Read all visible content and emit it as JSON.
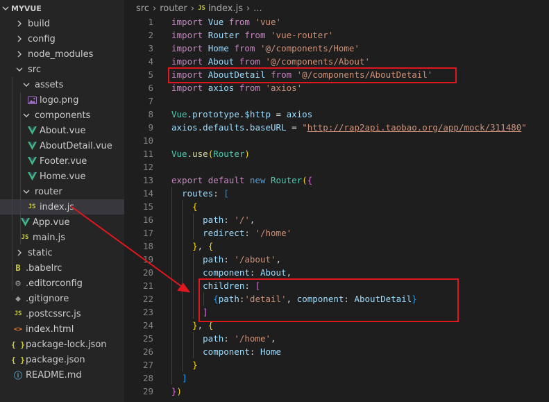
{
  "explorer": {
    "root": "MYVUE",
    "items": [
      {
        "label": "build",
        "type": "folder",
        "open": false
      },
      {
        "label": "config",
        "type": "folder",
        "open": false
      },
      {
        "label": "node_modules",
        "type": "folder",
        "open": false
      },
      {
        "label": "src",
        "type": "folder",
        "open": true
      },
      {
        "label": "assets",
        "type": "folder",
        "open": true
      },
      {
        "label": "logo.png",
        "type": "png"
      },
      {
        "label": "components",
        "type": "folder",
        "open": true
      },
      {
        "label": "About.vue",
        "type": "vue"
      },
      {
        "label": "AboutDetail.vue",
        "type": "vue"
      },
      {
        "label": "Footer.vue",
        "type": "vue"
      },
      {
        "label": "Home.vue",
        "type": "vue"
      },
      {
        "label": "router",
        "type": "folder",
        "open": true
      },
      {
        "label": "index.js",
        "type": "js",
        "selected": true
      },
      {
        "label": "App.vue",
        "type": "vue"
      },
      {
        "label": "main.js",
        "type": "js"
      },
      {
        "label": "static",
        "type": "folder",
        "open": false
      },
      {
        "label": ".babelrc",
        "type": "babel"
      },
      {
        "label": ".editorconfig",
        "type": "editor"
      },
      {
        "label": ".gitignore",
        "type": "git"
      },
      {
        "label": ".postcssrc.js",
        "type": "js"
      },
      {
        "label": "index.html",
        "type": "html"
      },
      {
        "label": "package-lock.json",
        "type": "json"
      },
      {
        "label": "package.json",
        "type": "json"
      },
      {
        "label": "README.md",
        "type": "info"
      }
    ]
  },
  "icons": {
    "folder_closed": "chevron-right-icon",
    "folder_open": "chevron-down-icon",
    "js": "JS",
    "json": "{ }",
    "html": "<>",
    "babel": "babel-icon",
    "editor": "⚙",
    "git": "◆",
    "info": "ⓘ",
    "png": "image-icon",
    "vue": "vue-logo-icon"
  },
  "breadcrumb": {
    "parts": [
      "src",
      "router",
      "index.js",
      "..."
    ],
    "js_badge": "JS"
  },
  "code_lines": [
    {
      "n": "1",
      "tokens": [
        [
          "kw",
          "import"
        ],
        [
          "pu",
          " "
        ],
        [
          "id",
          "Vue"
        ],
        [
          "pu",
          " "
        ],
        [
          "kw",
          "from"
        ],
        [
          "pu",
          " "
        ],
        [
          "str",
          "'vue'"
        ]
      ]
    },
    {
      "n": "2",
      "tokens": [
        [
          "kw",
          "import"
        ],
        [
          "pu",
          " "
        ],
        [
          "id",
          "Router"
        ],
        [
          "pu",
          " "
        ],
        [
          "kw",
          "from"
        ],
        [
          "pu",
          " "
        ],
        [
          "str",
          "'vue-router'"
        ]
      ]
    },
    {
      "n": "3",
      "tokens": [
        [
          "kw",
          "import"
        ],
        [
          "pu",
          " "
        ],
        [
          "id",
          "Home"
        ],
        [
          "pu",
          " "
        ],
        [
          "kw",
          "from"
        ],
        [
          "pu",
          " "
        ],
        [
          "str",
          "'@/components/Home'"
        ]
      ]
    },
    {
      "n": "4",
      "tokens": [
        [
          "kw",
          "import"
        ],
        [
          "pu",
          " "
        ],
        [
          "id",
          "About"
        ],
        [
          "pu",
          " "
        ],
        [
          "kw",
          "from"
        ],
        [
          "pu",
          " "
        ],
        [
          "str",
          "'@/components/About'"
        ]
      ]
    },
    {
      "n": "5",
      "tokens": [
        [
          "kw",
          "import"
        ],
        [
          "pu",
          " "
        ],
        [
          "id",
          "AboutDetail"
        ],
        [
          "pu",
          " "
        ],
        [
          "kw",
          "from"
        ],
        [
          "pu",
          " "
        ],
        [
          "str",
          "'@/components/AboutDetail'"
        ]
      ]
    },
    {
      "n": "6",
      "tokens": [
        [
          "kw",
          "import"
        ],
        [
          "pu",
          " "
        ],
        [
          "id",
          "axios"
        ],
        [
          "pu",
          " "
        ],
        [
          "kw",
          "from"
        ],
        [
          "pu",
          " "
        ],
        [
          "str",
          "'axios'"
        ]
      ]
    },
    {
      "n": "7",
      "tokens": []
    },
    {
      "n": "8",
      "tokens": [
        [
          "cls",
          "Vue"
        ],
        [
          "pu",
          "."
        ],
        [
          "id",
          "prototype"
        ],
        [
          "pu",
          "."
        ],
        [
          "id",
          "$http"
        ],
        [
          "pu",
          " = "
        ],
        [
          "id",
          "axios"
        ]
      ]
    },
    {
      "n": "9",
      "tokens": [
        [
          "id",
          "axios"
        ],
        [
          "pu",
          "."
        ],
        [
          "id",
          "defaults"
        ],
        [
          "pu",
          "."
        ],
        [
          "id",
          "baseURL"
        ],
        [
          "pu",
          " = "
        ],
        [
          "str",
          "\""
        ],
        [
          "url",
          "http://rap2api.taobao.org/app/mock/311480"
        ],
        [
          "str",
          "\""
        ]
      ]
    },
    {
      "n": "10",
      "tokens": []
    },
    {
      "n": "11",
      "tokens": [
        [
          "cls",
          "Vue"
        ],
        [
          "pu",
          "."
        ],
        [
          "fn",
          "use"
        ],
        [
          "br1",
          "("
        ],
        [
          "cls",
          "Router"
        ],
        [
          "br1",
          ")"
        ]
      ]
    },
    {
      "n": "12",
      "tokens": []
    },
    {
      "n": "13",
      "tokens": [
        [
          "kw",
          "export"
        ],
        [
          "pu",
          " "
        ],
        [
          "kw",
          "default"
        ],
        [
          "pu",
          " "
        ],
        [
          "bl",
          "new"
        ],
        [
          "pu",
          " "
        ],
        [
          "cls",
          "Router"
        ],
        [
          "br1",
          "("
        ],
        [
          "br2",
          "{"
        ]
      ]
    },
    {
      "n": "14",
      "tokens": [
        [
          "pu",
          "  "
        ],
        [
          "id",
          "routes"
        ],
        [
          "pu",
          ": "
        ],
        [
          "br3",
          "["
        ]
      ]
    },
    {
      "n": "15",
      "tokens": [
        [
          "pu",
          "    "
        ],
        [
          "br1",
          "{"
        ]
      ]
    },
    {
      "n": "16",
      "tokens": [
        [
          "pu",
          "      "
        ],
        [
          "id",
          "path"
        ],
        [
          "pu",
          ": "
        ],
        [
          "str",
          "'/'"
        ],
        [
          "pu",
          ","
        ]
      ]
    },
    {
      "n": "17",
      "tokens": [
        [
          "pu",
          "      "
        ],
        [
          "id",
          "redirect"
        ],
        [
          "pu",
          ": "
        ],
        [
          "str",
          "'/home'"
        ]
      ]
    },
    {
      "n": "18",
      "tokens": [
        [
          "pu",
          "    "
        ],
        [
          "br1",
          "}"
        ],
        [
          "pu",
          ", "
        ],
        [
          "br1",
          "{"
        ]
      ]
    },
    {
      "n": "19",
      "tokens": [
        [
          "pu",
          "      "
        ],
        [
          "id",
          "path"
        ],
        [
          "pu",
          ": "
        ],
        [
          "str",
          "'/about'"
        ],
        [
          "pu",
          ","
        ]
      ]
    },
    {
      "n": "20",
      "tokens": [
        [
          "pu",
          "      "
        ],
        [
          "id",
          "component"
        ],
        [
          "pu",
          ": "
        ],
        [
          "id",
          "About"
        ],
        [
          "pu",
          ","
        ]
      ]
    },
    {
      "n": "21",
      "tokens": [
        [
          "pu",
          "      "
        ],
        [
          "id",
          "children"
        ],
        [
          "pu",
          ": "
        ],
        [
          "br2",
          "["
        ]
      ]
    },
    {
      "n": "22",
      "tokens": [
        [
          "pu",
          "        "
        ],
        [
          "br3",
          "{"
        ],
        [
          "id",
          "path"
        ],
        [
          "pu",
          ":"
        ],
        [
          "str",
          "'detail'"
        ],
        [
          "pu",
          ", "
        ],
        [
          "id",
          "component"
        ],
        [
          "pu",
          ": "
        ],
        [
          "id",
          "AboutDetail"
        ],
        [
          "br3",
          "}"
        ]
      ]
    },
    {
      "n": "23",
      "tokens": [
        [
          "pu",
          "      "
        ],
        [
          "br2",
          "]"
        ]
      ]
    },
    {
      "n": "24",
      "tokens": [
        [
          "pu",
          "    "
        ],
        [
          "br1",
          "}"
        ],
        [
          "pu",
          ", "
        ],
        [
          "br1",
          "{"
        ]
      ]
    },
    {
      "n": "25",
      "tokens": [
        [
          "pu",
          "      "
        ],
        [
          "id",
          "path"
        ],
        [
          "pu",
          ": "
        ],
        [
          "str",
          "'/home'"
        ],
        [
          "pu",
          ","
        ]
      ]
    },
    {
      "n": "26",
      "tokens": [
        [
          "pu",
          "      "
        ],
        [
          "id",
          "component"
        ],
        [
          "pu",
          ": "
        ],
        [
          "id",
          "Home"
        ]
      ]
    },
    {
      "n": "27",
      "tokens": [
        [
          "pu",
          "    "
        ],
        [
          "br1",
          "}"
        ]
      ]
    },
    {
      "n": "28",
      "tokens": [
        [
          "pu",
          "  "
        ],
        [
          "br3",
          "]"
        ]
      ]
    },
    {
      "n": "29",
      "tokens": [
        [
          "br2",
          "}"
        ],
        [
          "br1",
          ")"
        ]
      ]
    }
  ],
  "colors": {
    "highlight_box": "#e0171e",
    "editor_bg": "#1e1e1e",
    "sidebar_bg": "#252526",
    "selected_row": "#37373d"
  }
}
